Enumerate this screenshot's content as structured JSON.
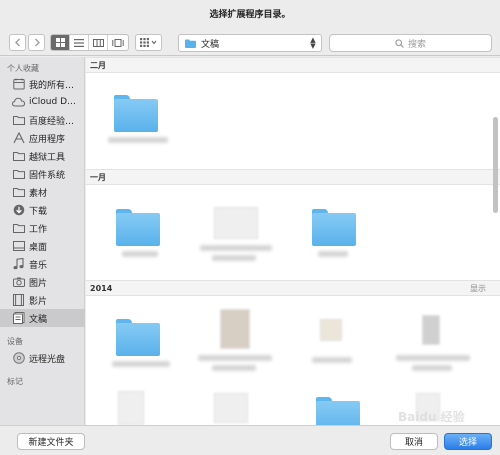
{
  "dialog": {
    "title": "选择扩展程序目录。"
  },
  "toolbar": {
    "back_icon": "chevron-left-icon",
    "forward_icon": "chevron-right-icon",
    "view_modes": [
      "icon-view-icon",
      "list-view-icon",
      "column-view-icon",
      "coverflow-view-icon"
    ],
    "active_view": "icon-view-icon",
    "arrange_icon": "arrange-grid-icon",
    "location": {
      "label": "文稿",
      "icon": "folder-icon"
    },
    "search": {
      "placeholder": "搜索",
      "icon": "search-icon"
    }
  },
  "sidebar": {
    "favorites_header": "个人收藏",
    "favorites": [
      {
        "label": "我的所有…",
        "icon": "all-files-icon"
      },
      {
        "label": "iCloud D…",
        "icon": "cloud-icon"
      },
      {
        "label": "百度经验…",
        "icon": "folder-icon"
      },
      {
        "label": "应用程序",
        "icon": "applications-icon"
      },
      {
        "label": "越狱工具",
        "icon": "folder-icon"
      },
      {
        "label": "固件系统",
        "icon": "folder-icon"
      },
      {
        "label": "素材",
        "icon": "folder-icon"
      },
      {
        "label": "下载",
        "icon": "download-icon"
      },
      {
        "label": "工作",
        "icon": "folder-icon"
      },
      {
        "label": "桌面",
        "icon": "desktop-icon"
      },
      {
        "label": "音乐",
        "icon": "music-icon"
      },
      {
        "label": "图片",
        "icon": "camera-icon"
      },
      {
        "label": "影片",
        "icon": "film-icon"
      },
      {
        "label": "文稿",
        "icon": "document-icon",
        "selected": true
      }
    ],
    "devices_header": "设备",
    "devices": [
      {
        "label": "远程光盘",
        "icon": "disc-icon"
      }
    ],
    "tags_header": "标记"
  },
  "content": {
    "sections": [
      {
        "label": "二月"
      },
      {
        "label": "一月"
      },
      {
        "label": "2014",
        "right_text": "显示"
      }
    ]
  },
  "footer": {
    "new_folder_label": "新建文件夹",
    "cancel_label": "取消",
    "choose_label": "选择"
  },
  "colors": {
    "accent": "#2c7de8",
    "folder": "#5ab2ec",
    "sidebar": "#e3e3e6"
  }
}
